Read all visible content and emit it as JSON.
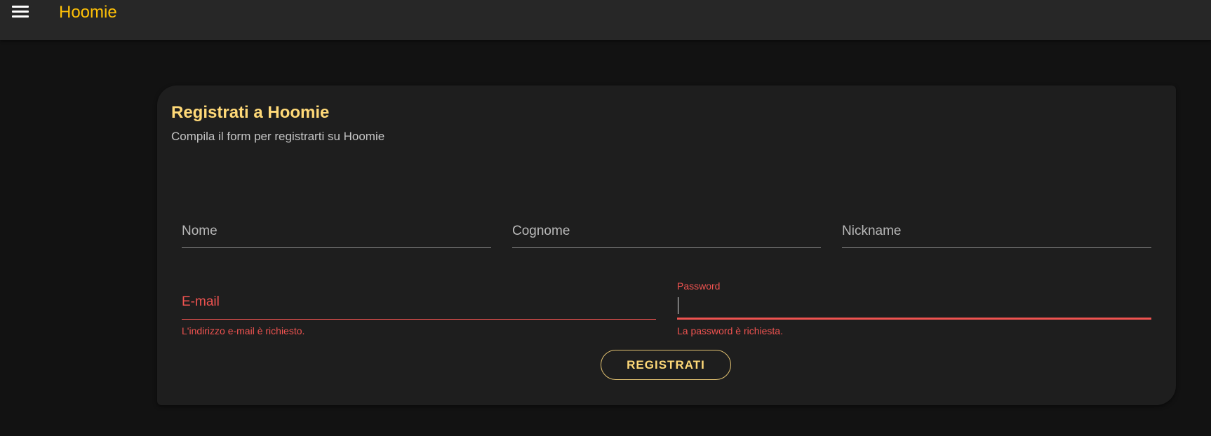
{
  "header": {
    "app_title": "Hoomie",
    "menu_icon": "hamburger-menu-icon",
    "accent_color": "#ffc107"
  },
  "form": {
    "title": "Registrati a Hoomie",
    "subtitle": "Compila il form per registrarti su Hoomie",
    "fields": {
      "nome": {
        "label": "Nome",
        "value": ""
      },
      "cognome": {
        "label": "Cognome",
        "value": ""
      },
      "nickname": {
        "label": "Nickname",
        "value": ""
      },
      "email": {
        "label": "E-mail",
        "value": "",
        "error": "L'indirizzo e-mail è richiesto."
      },
      "password": {
        "label": "Password",
        "value": "",
        "error": "La password è richiesta."
      }
    },
    "submit_label": "REGISTRATI",
    "error_color": "#ef5350"
  }
}
